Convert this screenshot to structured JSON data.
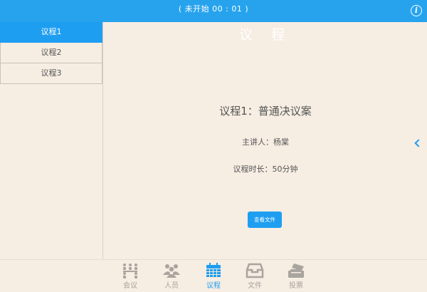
{
  "header": {
    "title": "议 程",
    "status": "( 未开始 00 : 01 )",
    "info_icon": "info-icon"
  },
  "sidebar": {
    "items": [
      {
        "label": "议程1",
        "active": true
      },
      {
        "label": "议程2",
        "active": false
      },
      {
        "label": "议程3",
        "active": false
      }
    ]
  },
  "main": {
    "agenda_title": "议程1：普通决议案",
    "presenter": "主讲人：杨棠",
    "duration": "议程时长：50分钟",
    "view_file_label": "查看文件",
    "collapse_icon": "chevron-left-icon"
  },
  "bottom_nav": {
    "items": [
      {
        "label": "会议",
        "icon": "meeting-icon",
        "active": false
      },
      {
        "label": "人员",
        "icon": "people-icon",
        "active": false
      },
      {
        "label": "议程",
        "icon": "calendar-icon",
        "active": true
      },
      {
        "label": "文件",
        "icon": "inbox-icon",
        "active": false
      },
      {
        "label": "投票",
        "icon": "vote-icon",
        "active": false
      }
    ]
  },
  "colors": {
    "accent": "#1e9ef1",
    "header": "#27a3ee",
    "background": "#f6ede3",
    "inactive_nav": "#a9a49e"
  }
}
